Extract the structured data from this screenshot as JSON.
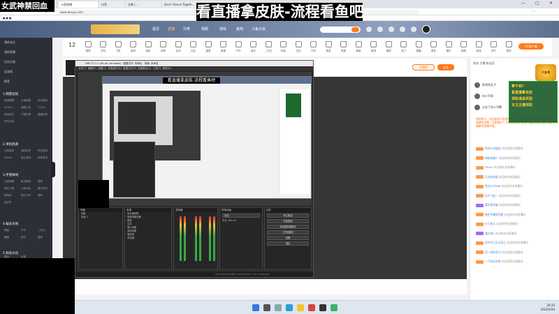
{
  "overlay": {
    "stream_name": "女武神禁回血",
    "title_banner": "看直播拿皮肤-流程看鱼吧"
  },
  "browser": {
    "tabs": [
      "斗鱼直播",
      "抖音",
      "文章 | ...",
      "Don't Starve Togeth...",
      "百度翻译"
    ],
    "address": "www.douyu.com"
  },
  "site": {
    "nav": [
      "首页",
      "直播",
      "分类",
      "视频",
      "游戏",
      "鱼吧",
      "斗鱼大会"
    ],
    "active_nav": "直播",
    "brand_color": "#ff7a1c",
    "pc_button": "PC客户端",
    "category_count": "12"
  },
  "sidebar": {
    "top_items": [
      "我的关注",
      "我的直播",
      "历史记录",
      "云游戏",
      "推荐"
    ],
    "sections": [
      {
        "title": "1.网游竞技",
        "items": [
          "英雄联盟",
          "王者荣耀",
          "和平精英",
          "DOTA2",
          "穿越火线",
          "CS:GO",
          "绝地求生",
          "守望先锋",
          "魔兽世界",
          "炉石传说"
        ]
      },
      {
        "title": "2.单机热游",
        "items": [
          "主机游戏",
          "我的世界",
          "怀旧游戏",
          "Steam",
          "独立游戏",
          "恐怖游戏"
        ]
      },
      {
        "title": "3.手游休闲",
        "items": [
          "王者荣耀",
          "和平精英",
          "原神",
          "第五人格",
          "火影忍者",
          "蛋仔派对",
          "阴阳师",
          "明日方舟",
          "崩坏",
          "金铲铲"
        ]
      },
      {
        "title": "4.娱乐天地",
        "items": [
          "颜值",
          "户外",
          "二次元",
          "舞蹈",
          "音乐",
          "星秀"
        ]
      },
      {
        "title": "5.科技文化",
        "items": [
          "数码",
          "科普"
        ]
      }
    ]
  },
  "categories": [
    "推荐",
    "手机",
    "飞机",
    "游戏",
    "竞技",
    "体育",
    "互动",
    "社区",
    "星秀",
    "美食",
    "户外",
    "音乐",
    "二次元",
    "科技",
    "文化",
    "汽车",
    "旅游",
    "电竞",
    "赛事",
    "鱼吧",
    "视频",
    "热门",
    "直播",
    "更多",
    "娱乐",
    "新闻",
    "游戏",
    "排行",
    "签到"
  ],
  "streamer": {
    "follow_label": "关注",
    "subscribe_label": "导播榜"
  },
  "obs": {
    "title": "OBS 27.2.1 (64-bit, windows) - 配置文件: 未命名 - 场景: 未命名",
    "menu": [
      "文件(F)",
      "编辑(E)",
      "视图(V)",
      "停靠部件(D)",
      "配置文件(P)",
      "场景集合(S)",
      "工具(T)",
      "帮助(H)"
    ],
    "docks": {
      "scenes": {
        "header": "场景",
        "items": [
          "场景",
          "场景 2"
        ]
      },
      "sources": {
        "header": "来源",
        "items": [
          "显示器采集",
          "视频采集设备",
          "图像",
          "文本",
          "窗口采集",
          "游戏采集",
          "媒体源",
          "浏览器"
        ]
      },
      "mixer": {
        "header": "混音器"
      },
      "transitions": {
        "header": "转场动画",
        "type": "淡出",
        "duration_label": "时长",
        "duration": "300 ms"
      },
      "controls": {
        "header": "控件",
        "buttons": [
          "停止推流",
          "开始录制",
          "启动虚拟摄像机",
          "工作室模式",
          "设置",
          "退出"
        ]
      }
    },
    "status": "LIVE: 00:00:00   REC: 00:00:00   CPU: 1.9%, 60.00 fps"
  },
  "chat": {
    "header": "贵宾 主播 粉丝团",
    "ranks": [
      {
        "name": "鱼哥的丸子"
      },
      {
        "name": "年少不知"
      },
      {
        "name": "心在了年少不羁"
      }
    ],
    "system_msg": "系统提示：欢迎来到斗鱼直播间，斗鱼严禁未成年人进行直播或打赏，请理性消费，注意保护个人隐私与财产安全，谨防网络诈骗，倡导文明健康的直播环境。",
    "messages": [
      {
        "user": "愿你心如猛虎",
        "text": "欢迎来到本直播间",
        "level": "o"
      },
      {
        "user": "神秘的路人",
        "text": "欢迎来到本直播间",
        "level": "o"
      },
      {
        "user": "Yiimm",
        "text": "欢迎来到本直播间",
        "level": "o"
      },
      {
        "user": "天边的流星",
        "text": "欢迎来到本直播间",
        "level": "o"
      },
      {
        "user": "鱼丸大户888",
        "text": "欢迎来到本直播间",
        "level": "o"
      },
      {
        "user": "天外飞仙丶",
        "text": "欢迎来到本直播间",
        "level": "o"
      },
      {
        "user": "爱吃鱼的猫",
        "text": "欢迎来到本直播间",
        "level": "p"
      },
      {
        "user": "夜空中最亮的星",
        "text": "欢迎来到本直播间",
        "level": "o"
      },
      {
        "user": "小小鱼儿",
        "text": "欢迎来到本直播间",
        "level": "o"
      },
      {
        "user": "路过的1",
        "text": "欢迎来到本直播间",
        "level": "p"
      },
      {
        "user": "好好学习天天向上",
        "text": "欢迎来到本直播间",
        "level": "o"
      },
      {
        "user": "风一样的男子",
        "text": "欢迎来到本直播间",
        "level": "o"
      },
      {
        "user": "一只快乐的鱼",
        "text": "欢迎来到本直播间",
        "level": "o"
      }
    ]
  },
  "promo": {
    "badge": "大金鸡",
    "lines": [
      "拿不到?",
      "看直播拿皮肤",
      "领取道具奖励",
      "关注主播领取"
    ]
  },
  "taskbar": {
    "time": "20:35",
    "date": "2022/4/26"
  }
}
